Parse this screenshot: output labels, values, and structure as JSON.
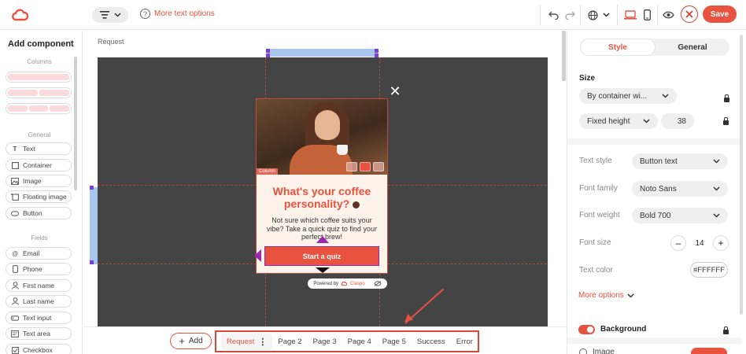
{
  "toolbar": {
    "more_text_options": "More text options",
    "save_label": "Save"
  },
  "left_panel": {
    "title": "Add component",
    "sections": {
      "columns": "Columns",
      "general": "General",
      "fields": "Fields"
    },
    "general_items": [
      "Text",
      "Container",
      "Image",
      "Floating image",
      "Button"
    ],
    "field_items": [
      "Email",
      "Phone",
      "First name",
      "Last name",
      "Text input",
      "Text area",
      "Checkbox"
    ]
  },
  "canvas": {
    "page_label": "Request",
    "popup": {
      "column_tag": "Column",
      "headline": "What's your coffee personality?",
      "subtext": "Not sure which coffee suits your vibe? Take a quick quiz to find your perfect brew!",
      "cta_label": "Start a quiz",
      "close_glyph": "✕"
    },
    "powered_by": {
      "prefix": "Powered by",
      "brand": "Claspo"
    }
  },
  "bottom_bar": {
    "add_label": "Add",
    "pages": [
      "Request",
      "Page 2",
      "Page 3",
      "Page 4",
      "Page 5",
      "Success",
      "Error"
    ],
    "active_page": "Request"
  },
  "right_panel": {
    "tabs": [
      "Style",
      "General"
    ],
    "active_tab": "Style",
    "size": {
      "heading": "Size",
      "width_mode": "By container wi...",
      "height_mode": "Fixed height",
      "height_value": "38"
    },
    "text": {
      "text_style_label": "Text style",
      "text_style_value": "Button text",
      "font_family_label": "Font family",
      "font_family_value": "Noto Sans",
      "font_weight_label": "Font weight",
      "font_weight_value": "Bold 700",
      "font_size_label": "Font size",
      "font_size_value": "14",
      "text_color_label": "Text color",
      "text_color_value": "#FFFFFF",
      "more_options": "More options"
    },
    "background": {
      "label": "Background",
      "image_option": "Image"
    }
  },
  "colors": {
    "accent": "#e8523f",
    "canvas_dark": "#444444",
    "popup_bg": "#fdf3ea",
    "selection_handle": "#9c27b0"
  }
}
